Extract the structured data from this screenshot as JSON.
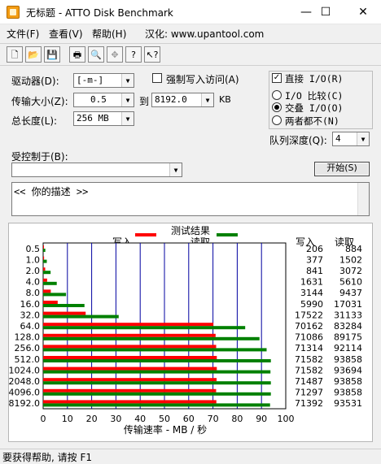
{
  "window": {
    "title": "无标题 - ATTO Disk Benchmark",
    "minimize": "—",
    "maximize": "☐",
    "close": "✕"
  },
  "menu": {
    "file": "文件(F)",
    "view": "查看(V)",
    "help": "帮助(H)",
    "credit": "汉化: www.upantool.com"
  },
  "toolbar": {
    "new": "🗋",
    "open": "📂",
    "save": "💾",
    "print": "🖶",
    "preview": "🔍",
    "move": "✥",
    "about": "?",
    "context_help": "↖?"
  },
  "settings": {
    "drive_label": "驱动器(D):",
    "drive_value": "[-m-]",
    "transfer_label": "传输大小(Z):",
    "transfer_from": "0.5",
    "to_label": "到",
    "transfer_to": "8192.0",
    "kb_label": "KB",
    "length_label": "总长度(L):",
    "length_value": "256 MB",
    "force_write_label": "强制写入访问(A)",
    "direct_io_label": "直接 I/O(R)",
    "io_compare_label": "I/O 比较(C)",
    "overlap_io_label": "交叠 I/O(O)",
    "neither_label": "两者都不(N)",
    "queue_label": "队列深度(Q):",
    "queue_value": "4",
    "controlled_label": "受控制于(B):",
    "controlled_value": "",
    "start_button": "开始(S)",
    "description": "<<  你的描述  >>"
  },
  "chart_data": {
    "type": "bar",
    "title": "测试结果",
    "xlabel": "传输速率 - MB / 秒",
    "xlim": [
      0,
      100
    ],
    "xticks": [
      0,
      10,
      20,
      30,
      40,
      50,
      60,
      70,
      80,
      90,
      100
    ],
    "col_write_label": "写入",
    "col_read_label": "读取",
    "categories": [
      "0.5",
      "1.0",
      "2.0",
      "4.0",
      "8.0",
      "16.0",
      "32.0",
      "64.0",
      "128.0",
      "256.0",
      "512.0",
      "1024.0",
      "2048.0",
      "4096.0",
      "8192.0"
    ],
    "series": [
      {
        "name": "写入",
        "color": "#ff0000",
        "values": [
          206,
          377,
          841,
          1631,
          3144,
          5990,
          17522,
          70162,
          71086,
          71314,
          71582,
          71582,
          71487,
          71297,
          71392
        ]
      },
      {
        "name": "读取",
        "color": "#008000",
        "values": [
          884,
          1502,
          3072,
          5610,
          9437,
          17031,
          31133,
          83284,
          89175,
          92114,
          93858,
          93694,
          93858,
          93858,
          93531
        ]
      }
    ]
  },
  "status": {
    "text": "要获得帮助, 请按 F1"
  }
}
